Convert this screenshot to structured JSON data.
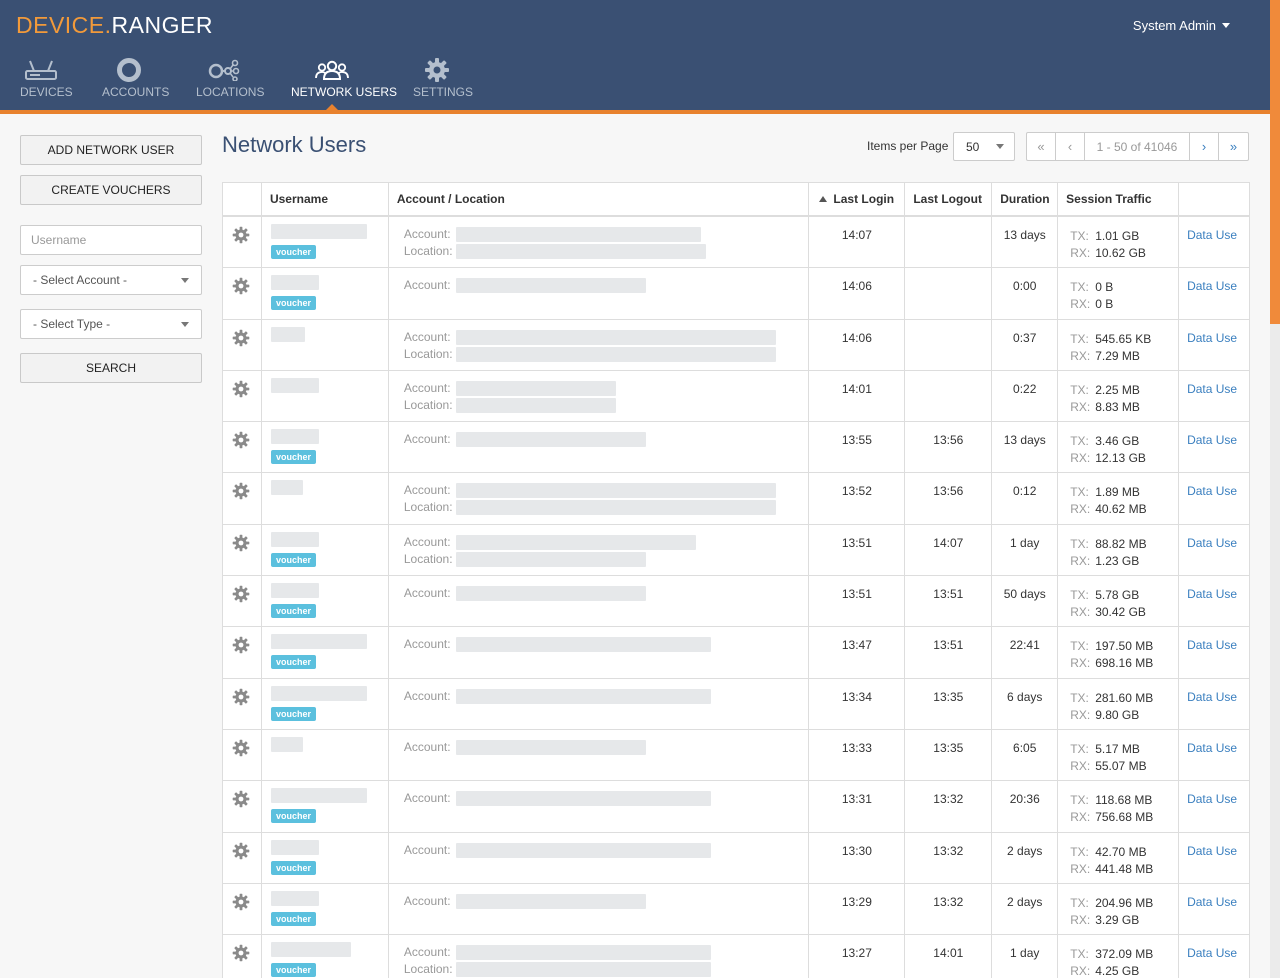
{
  "app": {
    "logo_part1": "DEVICE",
    "logo_dot": ".",
    "logo_part2": "RANGER",
    "user_menu": "System Admin"
  },
  "nav": [
    {
      "label": "Devices",
      "icon": "router-icon",
      "active": false
    },
    {
      "label": "Accounts",
      "icon": "account-ring-icon",
      "active": false
    },
    {
      "label": "Locations",
      "icon": "locations-icon",
      "active": false
    },
    {
      "label": "Network Users",
      "icon": "users-icon",
      "active": true
    },
    {
      "label": "Settings",
      "icon": "gear-icon",
      "active": false
    }
  ],
  "sidebar": {
    "add_button": "ADD NETWORK USER",
    "vouchers_button": "CREATE VOUCHERS",
    "username_placeholder": "Username",
    "select_account": "- Select Account -",
    "select_type": "- Select Type -",
    "search_button": "SEARCH"
  },
  "main": {
    "title": "Network Users",
    "items_per_page_label": "Items per Page",
    "items_per_page": "50",
    "pager_info": "1 - 50 of 41046"
  },
  "table": {
    "headers": [
      "",
      "Username",
      "Account / Location",
      "Last Login",
      "Last Logout",
      "Duration",
      "Session Traffic",
      ""
    ],
    "account_label": "Account:",
    "location_label": "Location:",
    "tx_label": "TX:",
    "rx_label": "RX:",
    "voucher_badge": "voucher",
    "data_use_link": "Data Use",
    "rows": [
      {
        "voucher": true,
        "has_location": true,
        "login": "14:07",
        "logout": "",
        "duration": "13 days",
        "tx": "1.01 GB",
        "rx": "10.62 GB"
      },
      {
        "voucher": true,
        "has_location": false,
        "login": "14:06",
        "logout": "",
        "duration": "0:00",
        "tx": "0 B",
        "rx": "0 B"
      },
      {
        "voucher": false,
        "has_location": true,
        "login": "14:06",
        "logout": "",
        "duration": "0:37",
        "tx": "545.65 KB",
        "rx": "7.29 MB"
      },
      {
        "voucher": false,
        "has_location": true,
        "login": "14:01",
        "logout": "",
        "duration": "0:22",
        "tx": "2.25 MB",
        "rx": "8.83 MB"
      },
      {
        "voucher": true,
        "has_location": false,
        "login": "13:55",
        "logout": "13:56",
        "duration": "13 days",
        "tx": "3.46 GB",
        "rx": "12.13 GB"
      },
      {
        "voucher": false,
        "has_location": true,
        "login": "13:52",
        "logout": "13:56",
        "duration": "0:12",
        "tx": "1.89 MB",
        "rx": "40.62 MB"
      },
      {
        "voucher": true,
        "has_location": true,
        "login": "13:51",
        "logout": "14:07",
        "duration": "1 day",
        "tx": "88.82 MB",
        "rx": "1.23 GB"
      },
      {
        "voucher": true,
        "has_location": false,
        "login": "13:51",
        "logout": "13:51",
        "duration": "50 days",
        "tx": "5.78 GB",
        "rx": "30.42 GB"
      },
      {
        "voucher": true,
        "has_location": false,
        "login": "13:47",
        "logout": "13:51",
        "duration": "22:41",
        "tx": "197.50 MB",
        "rx": "698.16 MB"
      },
      {
        "voucher": true,
        "has_location": false,
        "login": "13:34",
        "logout": "13:35",
        "duration": "6 days",
        "tx": "281.60 MB",
        "rx": "9.80 GB"
      },
      {
        "voucher": false,
        "has_location": false,
        "login": "13:33",
        "logout": "13:35",
        "duration": "6:05",
        "tx": "5.17 MB",
        "rx": "55.07 MB"
      },
      {
        "voucher": true,
        "has_location": false,
        "login": "13:31",
        "logout": "13:32",
        "duration": "20:36",
        "tx": "118.68 MB",
        "rx": "756.68 MB"
      },
      {
        "voucher": true,
        "has_location": false,
        "login": "13:30",
        "logout": "13:32",
        "duration": "2 days",
        "tx": "42.70 MB",
        "rx": "441.48 MB"
      },
      {
        "voucher": true,
        "has_location": false,
        "login": "13:29",
        "logout": "13:32",
        "duration": "2 days",
        "tx": "204.96 MB",
        "rx": "3.29 GB"
      },
      {
        "voucher": true,
        "has_location": true,
        "login": "13:27",
        "logout": "14:01",
        "duration": "1 day",
        "tx": "372.09 MB",
        "rx": "4.25 GB"
      }
    ]
  },
  "colors": {
    "header_bg": "#3a5073",
    "accent": "#e8822e",
    "link": "#3a7fbf",
    "badge": "#5bc0de"
  }
}
